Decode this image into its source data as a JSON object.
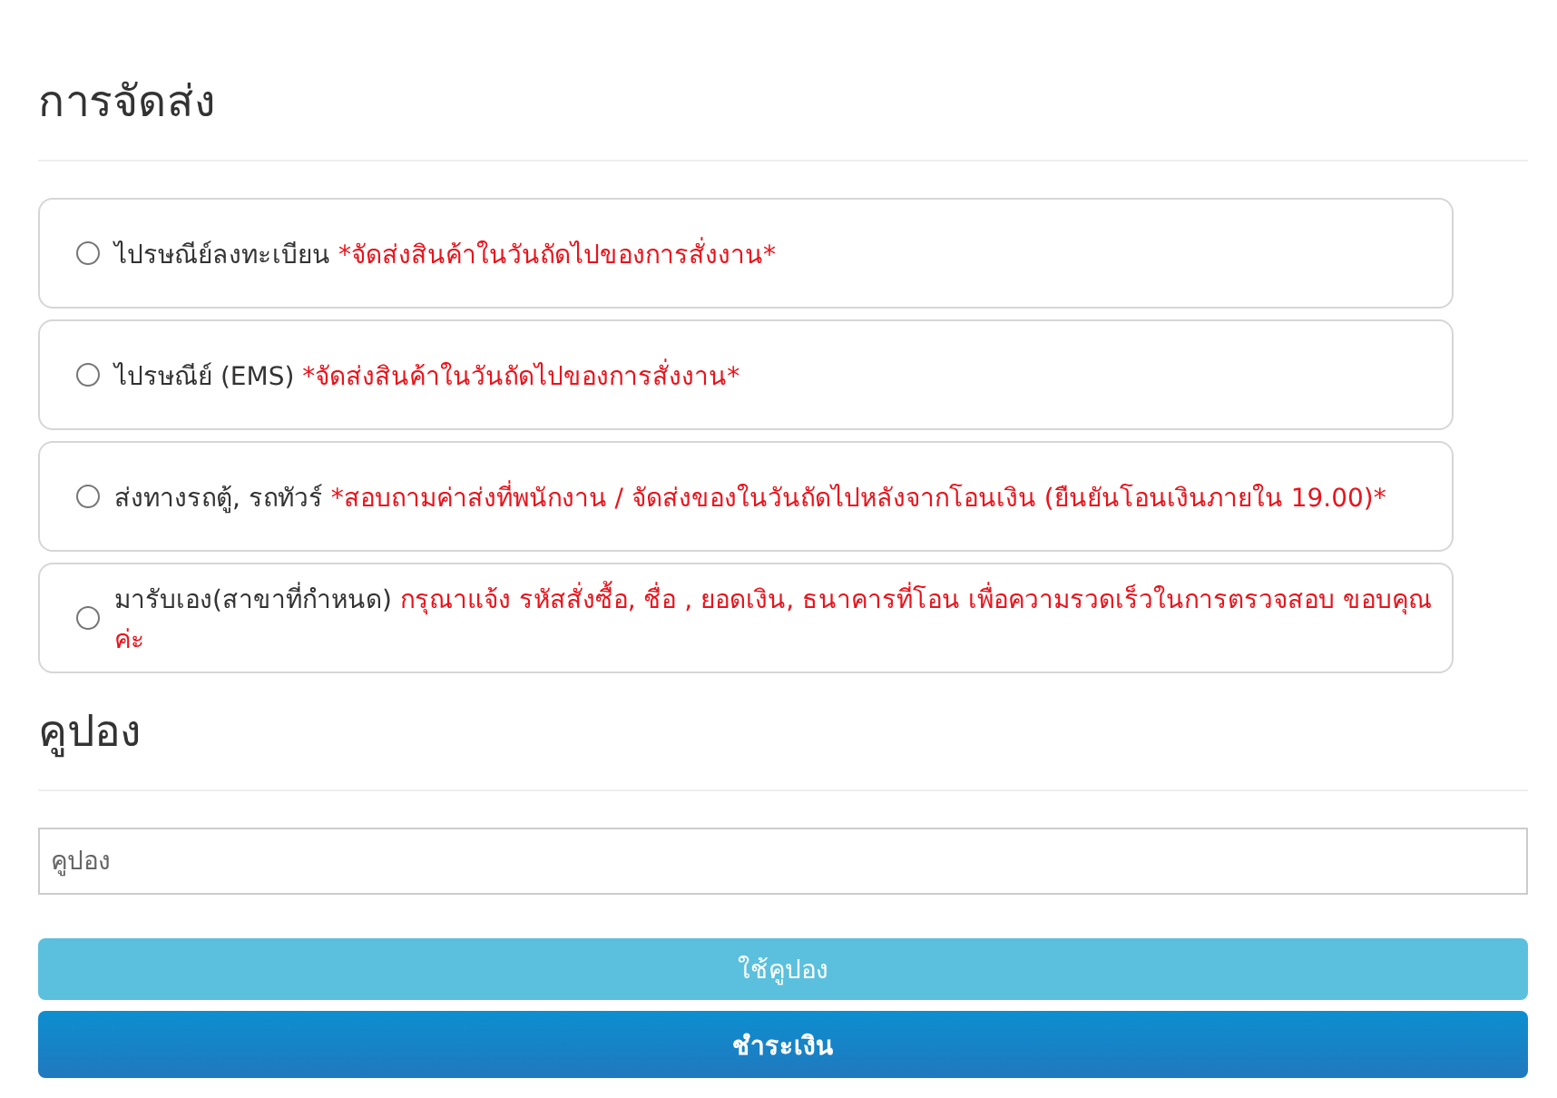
{
  "shipping": {
    "title": "การจัดส่ง",
    "options": [
      {
        "label": "ไปรษณีย์ลงทะเบียน",
        "note": "*จัดส่งสินค้าในวันถัดไปของการสั่งงาน*",
        "selected": false
      },
      {
        "label": "ไปรษณีย์ (EMS)",
        "note": "*จัดส่งสินค้าในวันถัดไปของการสั่งงาน*",
        "selected": false
      },
      {
        "label": "ส่งทางรถตู้, รถทัวร์",
        "note": "*สอบถามค่าส่งที่พนักงาน / จัดส่งของในวันถัดไปหลังจากโอนเงิน (ยืนยันโอนเงินภายใน 19.00)*",
        "selected": false
      },
      {
        "label": "มารับเอง(สาขาที่กำหนด)",
        "note": "กรุณาแจ้ง รหัสสั่งซื้อ, ชื่อ , ยอดเงิน, ธนาคารที่โอน เพื่อความรวดเร็วในการตรวจสอบ ขอบคุณค่ะ",
        "selected": false
      }
    ]
  },
  "coupon": {
    "title": "คูปอง",
    "placeholder": "คูปอง",
    "apply_button": "ใช้คูปอง"
  },
  "pay_button": "ชำระเงิน"
}
